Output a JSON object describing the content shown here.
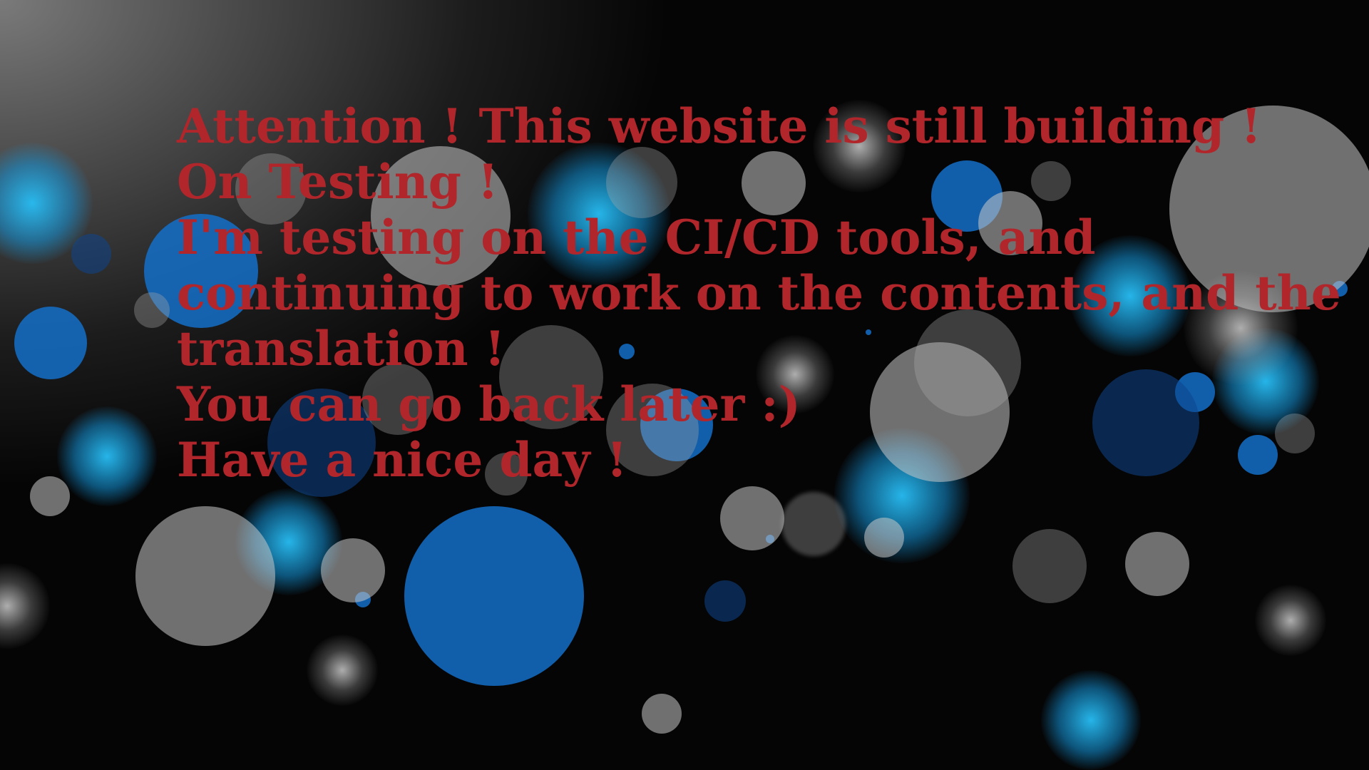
{
  "background": {
    "base_color": "#000000",
    "corner_highlight": "#7a7a7a",
    "bubble_colors": {
      "grey": "#c8c8c8",
      "blue": "#146ec8",
      "cyan": "#28bef5"
    }
  },
  "notice": {
    "color": "#b1262b",
    "lines": [
      "Attention ! This website is still building !",
      "On Testing !",
      "I'm testing on the CI/CD tools, and",
      "continuing to work on the contents, and the",
      "translation !",
      "You can go back later  :)",
      "Have a nice day !"
    ]
  }
}
